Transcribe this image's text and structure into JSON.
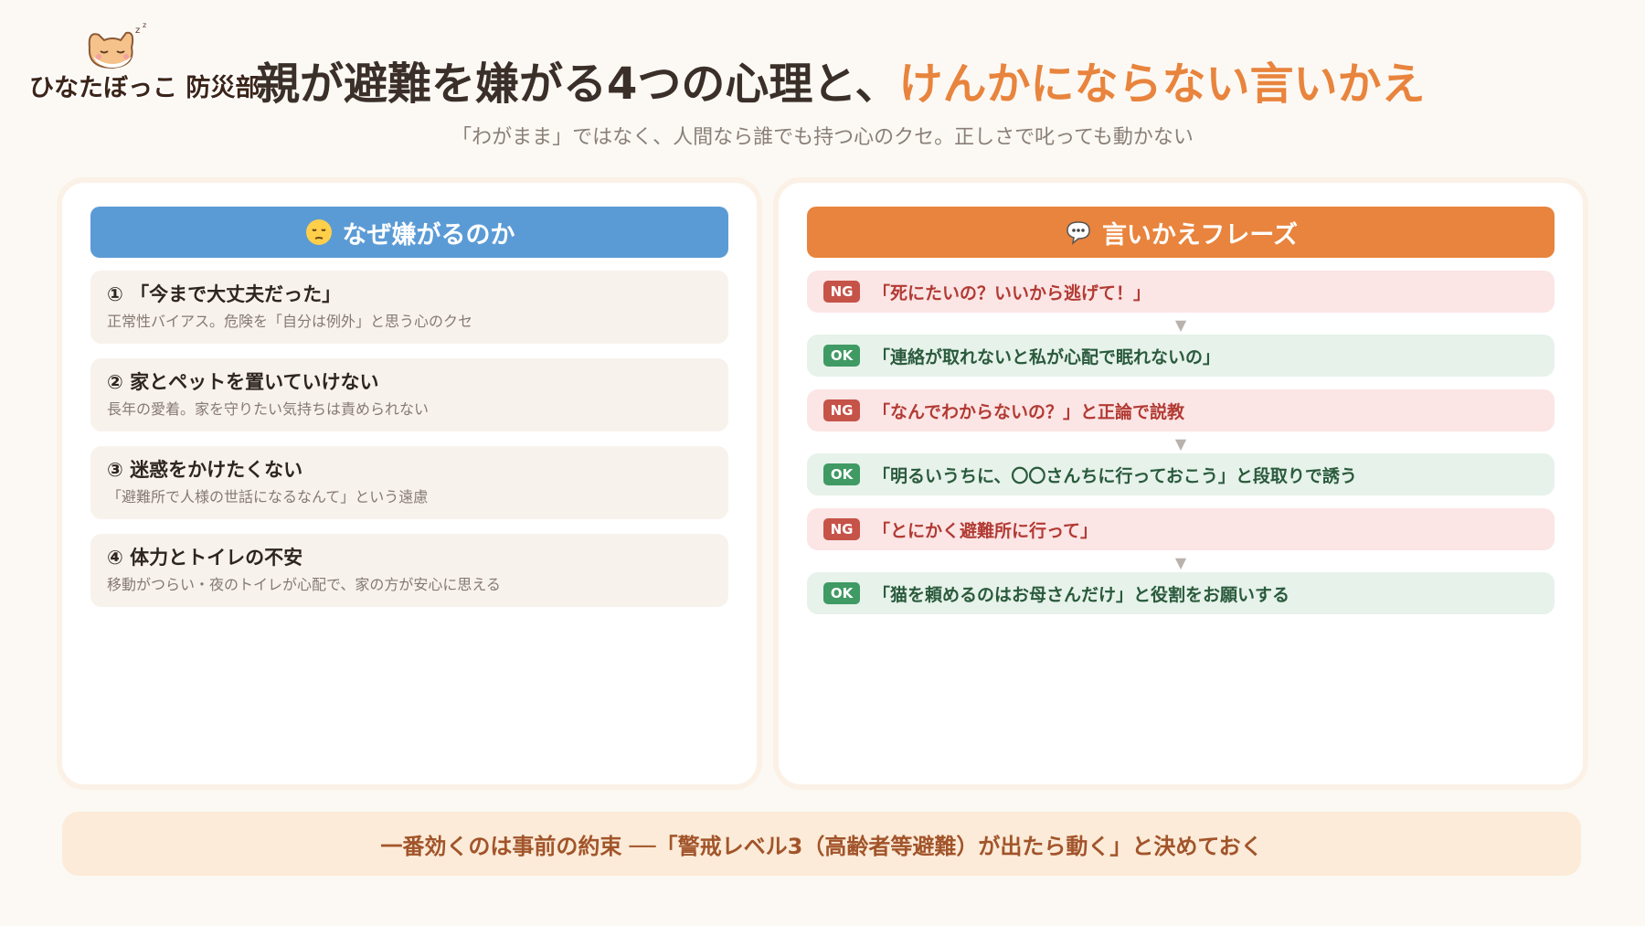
{
  "brand": {
    "name": "ひなたぼっこ 防災部",
    "mascot_icon": "sleeping-cat-icon"
  },
  "title": {
    "main": "親が避難を嫌がる4つの心理と、",
    "accent": "けんかにならない言いかえ"
  },
  "subtitle": "「わがまま」ではなく、人間なら誰でも持つ心のクセ。正しさで叱っても動かない",
  "left_panel": {
    "header_icon": "pensive-face-icon",
    "header": "なぜ嫌がるのか",
    "reasons": [
      {
        "title": "① 「今まで大丈夫だった」",
        "desc": "正常性バイアス。危険を「自分は例外」と思う心のクセ"
      },
      {
        "title": "② 家とペットを置いていけない",
        "desc": "長年の愛着。家を守りたい気持ちは責められない"
      },
      {
        "title": "③ 迷惑をかけたくない",
        "desc": "「避難所で人様の世話になるなんて」という遠慮"
      },
      {
        "title": "④ 体力とトイレの不安",
        "desc": "移動がつらい・夜のトイレが心配で、家の方が安心に思える"
      }
    ]
  },
  "right_panel": {
    "header_icon": "speech-bubble-icon",
    "header": "言いかえフレーズ",
    "pairs": [
      {
        "ng_tag": "NG",
        "ng": "「死にたいの？いいから逃げて！」",
        "ok_tag": "OK",
        "ok": "「連絡が取れないと私が心配で眠れないの」"
      },
      {
        "ng_tag": "NG",
        "ng": "「なんでわからないの？」と正論で説教",
        "ok_tag": "OK",
        "ok": "「明るいうちに、〇〇さんちに行っておこう」と段取りで誘う"
      },
      {
        "ng_tag": "NG",
        "ng": "「とにかく避難所に行って」",
        "ok_tag": "OK",
        "ok": "「猫を頼めるのはお母さんだけ」と役割をお願いする"
      }
    ],
    "arrow": "▼"
  },
  "footer": "一番効くのは事前の約束 ──「警戒レベル3（高齢者等避難）が出たら動く」と決めておく",
  "colors": {
    "accent_orange": "#e8843d",
    "header_blue": "#5b9bd5",
    "ng_red": "#c65348",
    "ok_green": "#3f9a63"
  }
}
